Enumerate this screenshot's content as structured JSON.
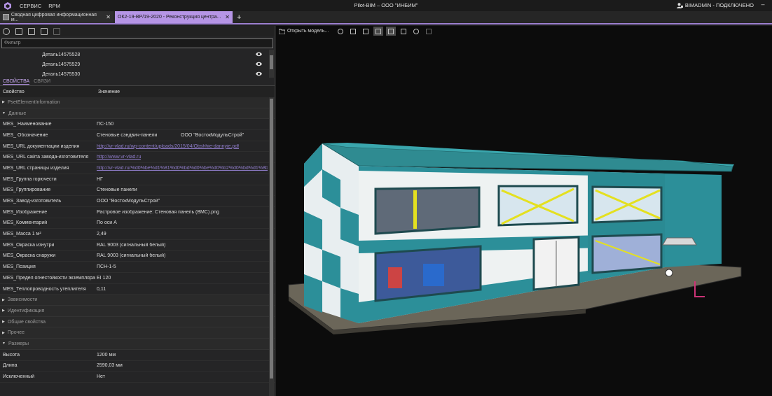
{
  "menu": {
    "service": "СЕРВИС",
    "rpm": "RPM"
  },
  "window_title": "Pilot-BIM – ООО \"ИНБИМ\"",
  "user": {
    "status": "BIMADMIN - ПОДКЛЮЧЕНО"
  },
  "tabs": [
    {
      "label": "Сводная цифровая информационная м...",
      "active": false
    },
    {
      "label": "ОК2-19-ВР/19-2020 - Реконструкция центра...",
      "active": true
    }
  ],
  "left": {
    "filter_placeholder": "Фильтр",
    "tree_items": [
      "Деталь14575528",
      "Деталь14575529",
      "Деталь14575530"
    ],
    "property_tabs": [
      "СВОЙСТВА",
      "СВЯЗИ"
    ],
    "columns": {
      "property": "Свойство",
      "value": "Значение"
    },
    "group_pset": "PsetElementInformation",
    "group_data": "Данные",
    "rows": [
      {
        "k": "MES_ Наименование",
        "v": "ПС-150"
      },
      {
        "k": "MES_ Обозначение",
        "v": "Стеновые сэндвич-панели",
        "v2": "ООО \"ВостокМодульСтрой\""
      },
      {
        "k": "MES_URL документации изделия",
        "v": "http://vr-vlad.ru/wp-content/uploads/2015/04/Obshhie-dannyie.pdf",
        "link": true
      },
      {
        "k": "MES_URL сайта завода-изготовителя",
        "v": "http://www.vr-vlad.ru",
        "link": true
      },
      {
        "k": "MES_URL страницы изделия",
        "v": "http://vr-vlad.ru/%d0%be%d1%81%d0%bd%d0%be%d0%b2%d0%bd%d1%8b",
        "link": true
      },
      {
        "k": "MES_Группа горючести",
        "v": "НГ"
      },
      {
        "k": "MES_Группирование",
        "v": "Стеновые панели"
      },
      {
        "k": "MES_Завод-изготовитель",
        "v": "ООО \"ВостокМодульСтрой\""
      },
      {
        "k": "MES_Изображение",
        "v": "Растровое изображение: Стеновая панель (ВМС).png"
      },
      {
        "k": "MES_Комментарий",
        "v": "По оси А"
      },
      {
        "k": "MES_Масса 1 м²",
        "v": "2,49"
      },
      {
        "k": "MES_Окраска изнутри",
        "v": "RAL 9003 (сигнальный белый)"
      },
      {
        "k": "MES_Окраска снаружи",
        "v": "RAL 9003 (сигнальный белый)"
      },
      {
        "k": "MES_Позиция",
        "v": "ПСН-1-5"
      },
      {
        "k": "MES_Предел огнестойкости экземпляра",
        "v": "EI 120"
      },
      {
        "k": "MES_Теплопроводность утеплителя",
        "v": "0,11"
      }
    ],
    "groups_after": [
      "Зависимости",
      "Идентификация",
      "Общие свойства",
      "Прочее"
    ],
    "group_sizes": "Размеры",
    "size_rows": [
      {
        "k": "Высота",
        "v": "1200 мм"
      },
      {
        "k": "Длина",
        "v": "2590,03 мм"
      },
      {
        "k": "Исключенный",
        "v": "Нет"
      }
    ]
  },
  "viewport": {
    "open_model_label": "Открыть модель..."
  },
  "colors": {
    "accent": "#b695e6",
    "teal": "#2a8f99",
    "panel": "#252526"
  }
}
